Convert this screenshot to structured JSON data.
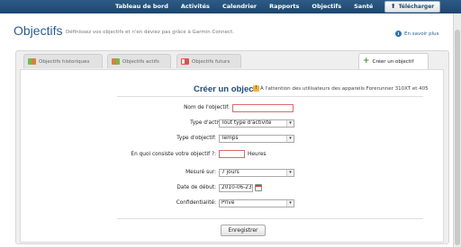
{
  "nav": {
    "items": [
      "Tableau de bord",
      "Activités",
      "Calendrier",
      "Rapports",
      "Objectifs",
      "Santé"
    ],
    "download_label": "Télécharger"
  },
  "header": {
    "title": "Objectifs",
    "subtitle": "Définissez vos objectifs et n'en déviez pas grâce à Garmin Connect.",
    "learn_more": "En savoir plus"
  },
  "tabs": [
    {
      "label": "Objectifs historiques",
      "icon": "history-icon"
    },
    {
      "label": "Objectifs actifs",
      "icon": "active-goals-icon"
    },
    {
      "label": "Objectifs futurs",
      "icon": "future-goals-icon"
    },
    {
      "label": "Créer un objectif",
      "icon": "plus-icon"
    }
  ],
  "form": {
    "heading": "Créer un objec",
    "note": "À l'attention des utilisateurs des appareils Forerunner 310XT et 405",
    "goal_name_label": "Nom de l'objectif:",
    "goal_name_value": "",
    "activity_type_label": "Type d'activité:",
    "activity_type_value": "Tout type d'activité",
    "goal_type_label": "Type d'objectif:",
    "goal_type_value": "Temps",
    "goal_amount_label": "En quoi consiste votre objectif ?:",
    "goal_amount_value": "",
    "hours_label": "Heures",
    "measured_label": "Mesuré sur:",
    "measured_value": "7 jours",
    "start_date_label": "Date de début:",
    "start_date_value": "2010-06-23",
    "privacy_label": "Confidentialité:",
    "privacy_value": "Privé",
    "save_label": "Enregistrer"
  }
}
